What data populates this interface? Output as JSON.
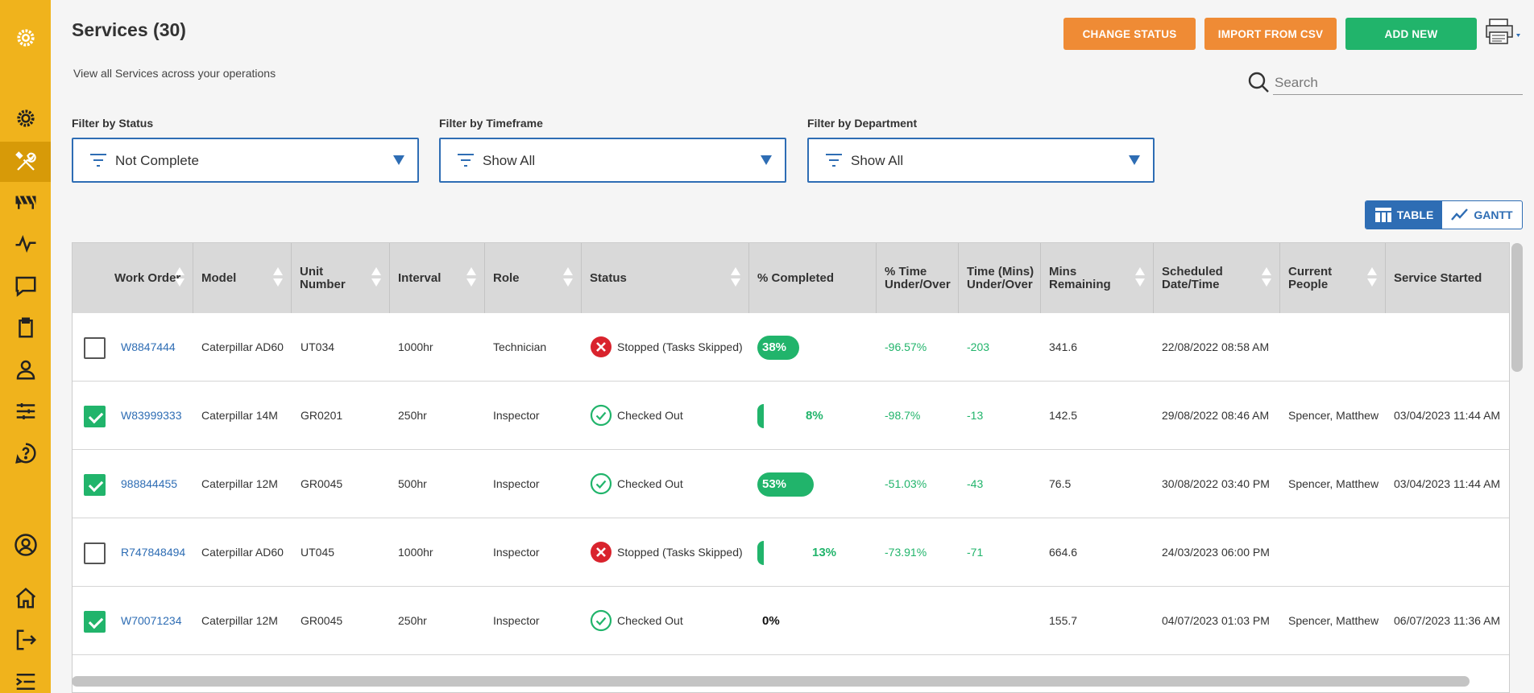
{
  "header": {
    "title": "Services (30)",
    "subtitle": "View all Services across your operations",
    "buttons": {
      "change_status": "CHANGE STATUS",
      "import_csv": "IMPORT FROM CSV",
      "add_new": "ADD NEW"
    },
    "search_placeholder": "Search"
  },
  "filters": [
    {
      "label": "Filter by Status",
      "value": "Not Complete"
    },
    {
      "label": "Filter by Timeframe",
      "value": "Show All"
    },
    {
      "label": "Filter by Department",
      "value": "Show All"
    }
  ],
  "view_toggle": {
    "table": "TABLE",
    "gantt": "GANTT",
    "active": "table"
  },
  "columns": [
    "Work Order",
    "Model",
    "Unit Number",
    "Interval",
    "Role",
    "Status",
    "% Completed",
    "% Time Under/Over",
    "Time (Mins) Under/Over",
    "Mins Remaining",
    "Scheduled Date/Time",
    "Current People",
    "Service Started"
  ],
  "rows": [
    {
      "checked": false,
      "work_order": "W8847444",
      "model": "Caterpillar AD60",
      "unit": "UT034",
      "interval": "1000hr",
      "role": "Technician",
      "status": "Stopped (Tasks Skipped)",
      "status_type": "stopped",
      "pct_completed": "38%",
      "pct_value": 38,
      "pct_time": "-96.57%",
      "time_mins": "-203",
      "mins_remaining": "341.6",
      "scheduled": "22/08/2022 08:58 AM",
      "people": "",
      "started": ""
    },
    {
      "checked": true,
      "work_order": "W83999333",
      "model": "Caterpillar 14M",
      "unit": "GR0201",
      "interval": "250hr",
      "role": "Inspector",
      "status": "Checked Out",
      "status_type": "checked",
      "pct_completed": "8%",
      "pct_value": 8,
      "pct_time": "-98.7%",
      "time_mins": "-13",
      "mins_remaining": "142.5",
      "scheduled": "29/08/2022 08:46 AM",
      "people": "Spencer, Matthew",
      "started": "03/04/2023 11:44 AM"
    },
    {
      "checked": true,
      "work_order": "988844455",
      "model": "Caterpillar 12M",
      "unit": "GR0045",
      "interval": "500hr",
      "role": "Inspector",
      "status": "Checked Out",
      "status_type": "checked",
      "pct_completed": "53%",
      "pct_value": 53,
      "pct_time": "-51.03%",
      "time_mins": "-43",
      "mins_remaining": "76.5",
      "scheduled": "30/08/2022 03:40 PM",
      "people": "Spencer, Matthew",
      "started": "03/04/2023 11:44 AM"
    },
    {
      "checked": false,
      "work_order": "R747848494",
      "model": "Caterpillar AD60",
      "unit": "UT045",
      "interval": "1000hr",
      "role": "Inspector",
      "status": "Stopped (Tasks Skipped)",
      "status_type": "stopped",
      "pct_completed": "13%",
      "pct_value": 13,
      "pct_time": "-73.91%",
      "time_mins": "-71",
      "mins_remaining": "664.6",
      "scheduled": "24/03/2023 06:00 PM",
      "people": "",
      "started": ""
    },
    {
      "checked": true,
      "work_order": "W70071234",
      "model": "Caterpillar 12M",
      "unit": "GR0045",
      "interval": "250hr",
      "role": "Inspector",
      "status": "Checked Out",
      "status_type": "checked",
      "pct_completed": "0%",
      "pct_value": 0,
      "pct_time": "",
      "time_mins": "",
      "mins_remaining": "155.7",
      "scheduled": "04/07/2023 01:03 PM",
      "people": "Spencer, Matthew",
      "started": "06/07/2023 11:36 AM"
    }
  ],
  "icons": {
    "sidebar": [
      "logo-gear-icon",
      "gear-icon",
      "tools-icon",
      "barrier-icon",
      "activity-icon",
      "chat-icon",
      "clipboard-icon",
      "user-icon",
      "sliders-icon",
      "help-icon",
      "profile-icon",
      "home-icon",
      "logout-icon",
      "menu-collapse-icon"
    ]
  },
  "colors": {
    "sidebar": "#f0b31c",
    "sidebar_active": "#d79a08",
    "orange_button": "#ef8b35",
    "green": "#21b46b",
    "blue": "#2e6db4",
    "stopped_red": "#d9232d"
  }
}
